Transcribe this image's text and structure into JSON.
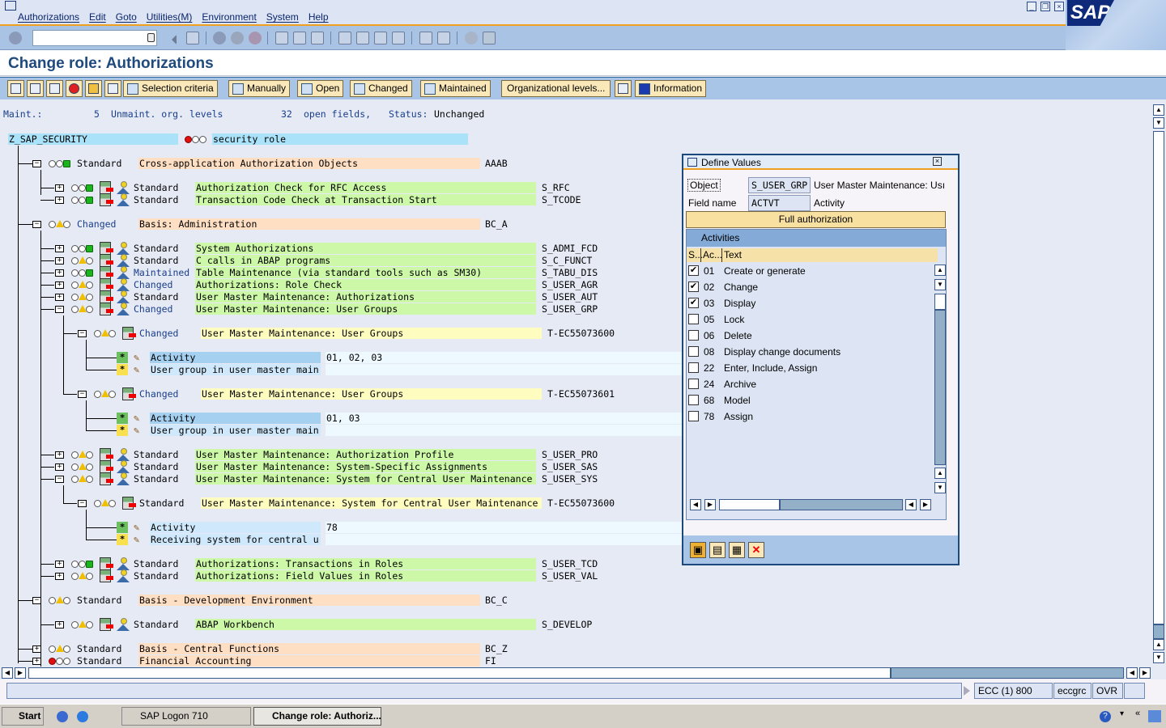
{
  "window": {
    "menu": [
      "Authorizations",
      "Edit",
      "Goto",
      "Utilities(M)",
      "Environment",
      "System",
      "Help"
    ],
    "logo_text": "SAP",
    "command_field_value": ""
  },
  "page": {
    "title": "Change role: Authorizations"
  },
  "app_toolbar": {
    "buttons": [
      "Selection criteria",
      "Manually",
      "Open",
      "Changed",
      "Maintained",
      "Organizational levels...",
      "Information"
    ]
  },
  "summary": {
    "maint_label": "Maint.:",
    "unmaint_count": "5",
    "unmaint_label": "Unmaint. org. levels",
    "open_count": "32",
    "open_label": "open fields,",
    "status_label": "Status:",
    "status_value": "Unchanged"
  },
  "tree": {
    "root": {
      "name": "Z_SAP_SECURITY",
      "text": "security role",
      "light": "red"
    },
    "rows": [
      {
        "level": 1,
        "exp": "-",
        "light": "green",
        "status": "Standard",
        "text": "Cross-application Authorization Objects",
        "code": "AAAB",
        "kind": "class"
      },
      {
        "level": 2,
        "exp": "+",
        "light": "green",
        "status": "Standard",
        "text": "Authorization Check for RFC Access",
        "code": "S_RFC",
        "kind": "object"
      },
      {
        "level": 2,
        "exp": "+",
        "light": "green",
        "status": "Standard",
        "text": "Transaction Code Check at Transaction Start",
        "code": "S_TCODE",
        "kind": "object"
      },
      {
        "level": 1,
        "exp": "-",
        "light": "yellow",
        "status": "Changed",
        "text": "Basis: Administration",
        "code": "BC_A",
        "kind": "class"
      },
      {
        "level": 2,
        "exp": "+",
        "light": "green",
        "status": "Standard",
        "text": "System Authorizations",
        "code": "S_ADMI_FCD",
        "kind": "object"
      },
      {
        "level": 2,
        "exp": "+",
        "light": "yellow",
        "status": "Standard",
        "text": "C calls in ABAP programs",
        "code": "S_C_FUNCT",
        "kind": "object"
      },
      {
        "level": 2,
        "exp": "+",
        "light": "green",
        "status": "Maintained",
        "text": "Table Maintenance (via standard tools such as SM30)",
        "code": "S_TABU_DIS",
        "kind": "object"
      },
      {
        "level": 2,
        "exp": "+",
        "light": "yellow",
        "status": "Changed",
        "text": "Authorizations: Role Check",
        "code": "S_USER_AGR",
        "kind": "object"
      },
      {
        "level": 2,
        "exp": "+",
        "light": "yellow",
        "status": "Standard",
        "text": "User Master Maintenance: Authorizations",
        "code": "S_USER_AUT",
        "kind": "object"
      },
      {
        "level": 2,
        "exp": "-",
        "light": "yellow",
        "status": "Changed",
        "text": "User Master Maintenance: User Groups",
        "code": "S_USER_GRP",
        "kind": "object"
      },
      {
        "level": 3,
        "exp": "-",
        "light": "yellow",
        "status": "Changed",
        "text": "User Master Maintenance: User Groups",
        "code": "T-EC55073600",
        "kind": "auth"
      },
      {
        "level": 4,
        "star": "green",
        "field": "Activity",
        "value": "01, 02, 03",
        "kind": "field",
        "selected": true
      },
      {
        "level": 4,
        "star": "yellow",
        "field": "User group in user master main",
        "value": "",
        "kind": "field"
      },
      {
        "level": 3,
        "exp": "-",
        "light": "yellow",
        "status": "Changed",
        "text": "User Master Maintenance: User Groups",
        "code": "T-EC55073601",
        "kind": "auth"
      },
      {
        "level": 4,
        "star": "green",
        "field": "Activity",
        "value": "01, 03",
        "kind": "field",
        "selected": true
      },
      {
        "level": 4,
        "star": "yellow",
        "field": "User group in user master main",
        "value": "",
        "kind": "field"
      },
      {
        "level": 2,
        "exp": "+",
        "light": "yellow",
        "status": "Standard",
        "text": "User Master Maintenance: Authorization Profile",
        "code": "S_USER_PRO",
        "kind": "object"
      },
      {
        "level": 2,
        "exp": "+",
        "light": "yellow",
        "status": "Standard",
        "text": "User Master Maintenance: System-Specific Assignments",
        "code": "S_USER_SAS",
        "kind": "object"
      },
      {
        "level": 2,
        "exp": "-",
        "light": "yellow",
        "status": "Standard",
        "text": "User Master Maintenance: System for Central User Maintenance",
        "code": "S_USER_SYS",
        "kind": "object"
      },
      {
        "level": 3,
        "exp": "-",
        "light": "yellow",
        "status": "Standard",
        "text": "User Master Maintenance: System for Central User Maintenance",
        "code": "T-EC55073600",
        "kind": "auth"
      },
      {
        "level": 4,
        "star": "green",
        "field": "Activity",
        "value": "78",
        "kind": "field"
      },
      {
        "level": 4,
        "star": "yellow",
        "field": "Receiving system for central u",
        "value": "",
        "kind": "field"
      },
      {
        "level": 2,
        "exp": "+",
        "light": "green",
        "status": "Standard",
        "text": "Authorizations: Transactions in Roles",
        "code": "S_USER_TCD",
        "kind": "object"
      },
      {
        "level": 2,
        "exp": "+",
        "light": "yellow",
        "status": "Standard",
        "text": "Authorizations: Field Values in Roles",
        "code": "S_USER_VAL",
        "kind": "object"
      },
      {
        "level": 1,
        "exp": "-",
        "light": "yellow",
        "status": "Standard",
        "text": "Basis - Development Environment",
        "code": "BC_C",
        "kind": "class"
      },
      {
        "level": 2,
        "exp": "+",
        "light": "yellow",
        "status": "Standard",
        "text": "ABAP Workbench",
        "code": "S_DEVELOP",
        "kind": "object"
      },
      {
        "level": 1,
        "exp": "+",
        "light": "yellow",
        "status": "Standard",
        "text": "Basis - Central Functions",
        "code": "BC_Z",
        "kind": "class"
      },
      {
        "level": 1,
        "exp": "+",
        "light": "red",
        "status": "Standard",
        "text": "Financial Accounting",
        "code": "FI",
        "kind": "class"
      }
    ]
  },
  "dialog": {
    "title": "Define Values",
    "object_label": "Object",
    "object_value": "S_USER_GRP",
    "object_desc": "User Master Maintenance: Usı",
    "field_label": "Field name",
    "field_value": "ACTVT",
    "field_desc": "Activity",
    "full_auth": "Full authorization",
    "section": "Activities",
    "columns": [
      "S...",
      "Ac...",
      "Text"
    ],
    "activities": [
      {
        "code": "01",
        "text": "Create or generate",
        "checked": true
      },
      {
        "code": "02",
        "text": "Change",
        "checked": true
      },
      {
        "code": "03",
        "text": "Display",
        "checked": true
      },
      {
        "code": "05",
        "text": "Lock",
        "checked": false
      },
      {
        "code": "06",
        "text": "Delete",
        "checked": false
      },
      {
        "code": "08",
        "text": "Display change documents",
        "checked": false
      },
      {
        "code": "22",
        "text": "Enter, Include, Assign",
        "checked": false
      },
      {
        "code": "24",
        "text": "Archive",
        "checked": false
      },
      {
        "code": "68",
        "text": "Model",
        "checked": false
      },
      {
        "code": "78",
        "text": "Assign",
        "checked": false
      }
    ]
  },
  "statusbar": {
    "system": "ECC (1) 800",
    "server": "eccgrc",
    "mode": "OVR"
  },
  "taskbar": {
    "start": "Start",
    "tasks": [
      "SAP Logon 710",
      "Change role: Authoriz..."
    ]
  },
  "colors": {
    "accent": "#f0a020",
    "title": "#1e4a7e",
    "class_bg": "#ffdfc4",
    "object_bg": "#ccf8a8",
    "auth_bg": "#fffcc0",
    "field_bg": "#a6d0f0",
    "root_bg": "#aae2fa"
  }
}
